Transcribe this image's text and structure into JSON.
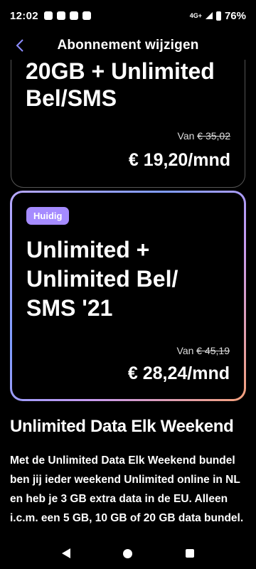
{
  "status": {
    "time": "12:02",
    "network": "4G+",
    "battery": "76%"
  },
  "header": {
    "title": "Abonnement wijzigen"
  },
  "plans": [
    {
      "title": "20GB + Unlimited Bel/SMS",
      "from_label": "Van",
      "old_price": "€ 35,02",
      "price": "€ 19,20/mnd"
    },
    {
      "badge": "Huidig",
      "title": "Unlimited + Unlimited Bel/ SMS '21",
      "from_label": "Van",
      "old_price": "€ 45,19",
      "price": "€ 28,24/mnd"
    }
  ],
  "bundle": {
    "title": "Unlimited Data Elk Weekend",
    "description": "Met de Unlimited Data Elk Weekend bundel ben jij ieder weekend Unlimited online in NL en heb je 3 GB extra data in de EU. Alleen i.c.m. een 5 GB, 10 GB of 20 GB data bundel."
  },
  "icons": {
    "back": "chevron-left-icon",
    "nav_back": "triangle-back-icon",
    "nav_home": "circle-home-icon",
    "nav_recent": "square-recents-icon"
  },
  "colors": {
    "accent": "#a58bff",
    "background": "#000000"
  }
}
